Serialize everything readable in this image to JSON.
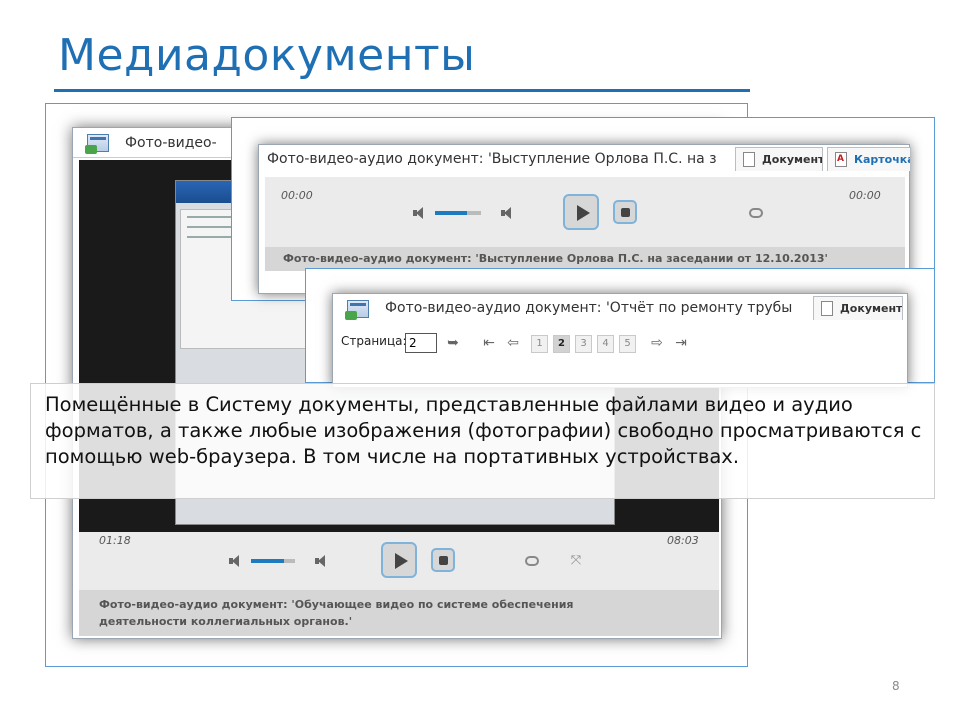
{
  "slide": {
    "title": "Медиадокументы",
    "page_number": "8",
    "caption": "Помещённые в Систему документы, представленные файлами видео и аудио форматов, а также любые изображения (фотографии) свободно просматриваются с помощью web-браузера. В том числе на портативных устройствах."
  },
  "video_window": {
    "title": "Фото-видео-аудио документ: 'Обучающее видео по системе обеспечения деятельности коллегиальных органов.'",
    "title_short": "Фото-видео-",
    "time_current": "01:18",
    "time_total": "08:03",
    "volume_level": 0.75,
    "footer": "Фото-видео-аудио документ: 'Обучающее видео по системе обеспечения деятельности коллегиальных органов.'"
  },
  "audio_window": {
    "title": "Фото-видео-аудио документ: 'Выступление Орлова П.С. на з",
    "tabs": [
      {
        "label": "Документ",
        "icon": "document-icon"
      },
      {
        "label": "Карточка",
        "icon": "pdf-icon"
      }
    ],
    "time_current": "00:00",
    "time_total": "00:00",
    "volume_level": 0.7,
    "footer": "Фото-видео-аудио документ: 'Выступление Орлова П.С. на заседании от 12.10.2013'"
  },
  "photo_window": {
    "title": "Фото-видео-аудио документ: 'Отчёт по ремонту трубы",
    "tabs": [
      {
        "label": "Документ",
        "icon": "document-icon"
      }
    ],
    "pager": {
      "label": "Страница:",
      "value": "2",
      "pages": [
        "1",
        "2",
        "3",
        "4",
        "5"
      ],
      "active_page": "2"
    }
  },
  "colors": {
    "accent": "#1f6fb4",
    "button_border": "#7fb3d9",
    "volume_fill": "#1e7bc0"
  }
}
